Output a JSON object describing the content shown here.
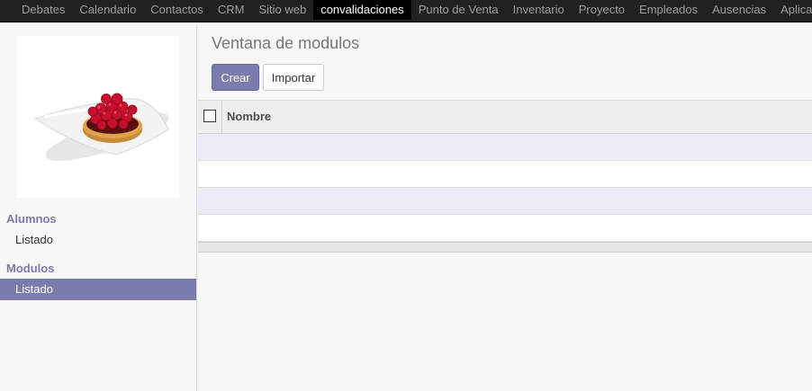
{
  "topbar": {
    "menu": [
      {
        "label": "Debates"
      },
      {
        "label": "Calendario"
      },
      {
        "label": "Contactos"
      },
      {
        "label": "CRM"
      },
      {
        "label": "Sitio web"
      },
      {
        "label": "convalidaciones",
        "active": true
      },
      {
        "label": "Punto de Venta"
      },
      {
        "label": "Inventario"
      },
      {
        "label": "Proyecto"
      },
      {
        "label": "Empleados"
      },
      {
        "label": "Ausencias"
      },
      {
        "label": "Aplicaciones"
      }
    ]
  },
  "sidebar": {
    "sections": [
      {
        "title": "Alumnos",
        "items": [
          {
            "label": "Listado",
            "active": false
          }
        ]
      },
      {
        "title": "Modulos",
        "items": [
          {
            "label": "Listado",
            "active": true
          }
        ]
      }
    ]
  },
  "main": {
    "breadcrumb": "Ventana de modulos",
    "buttons": {
      "create": "Crear",
      "import": "Importar"
    },
    "list": {
      "columns": [
        "Nombre"
      ],
      "rows": [],
      "empty_row_count": 4
    }
  },
  "colors": {
    "accent": "#7c7bad",
    "navbar": "#212121",
    "navbar_active": "#000000"
  }
}
